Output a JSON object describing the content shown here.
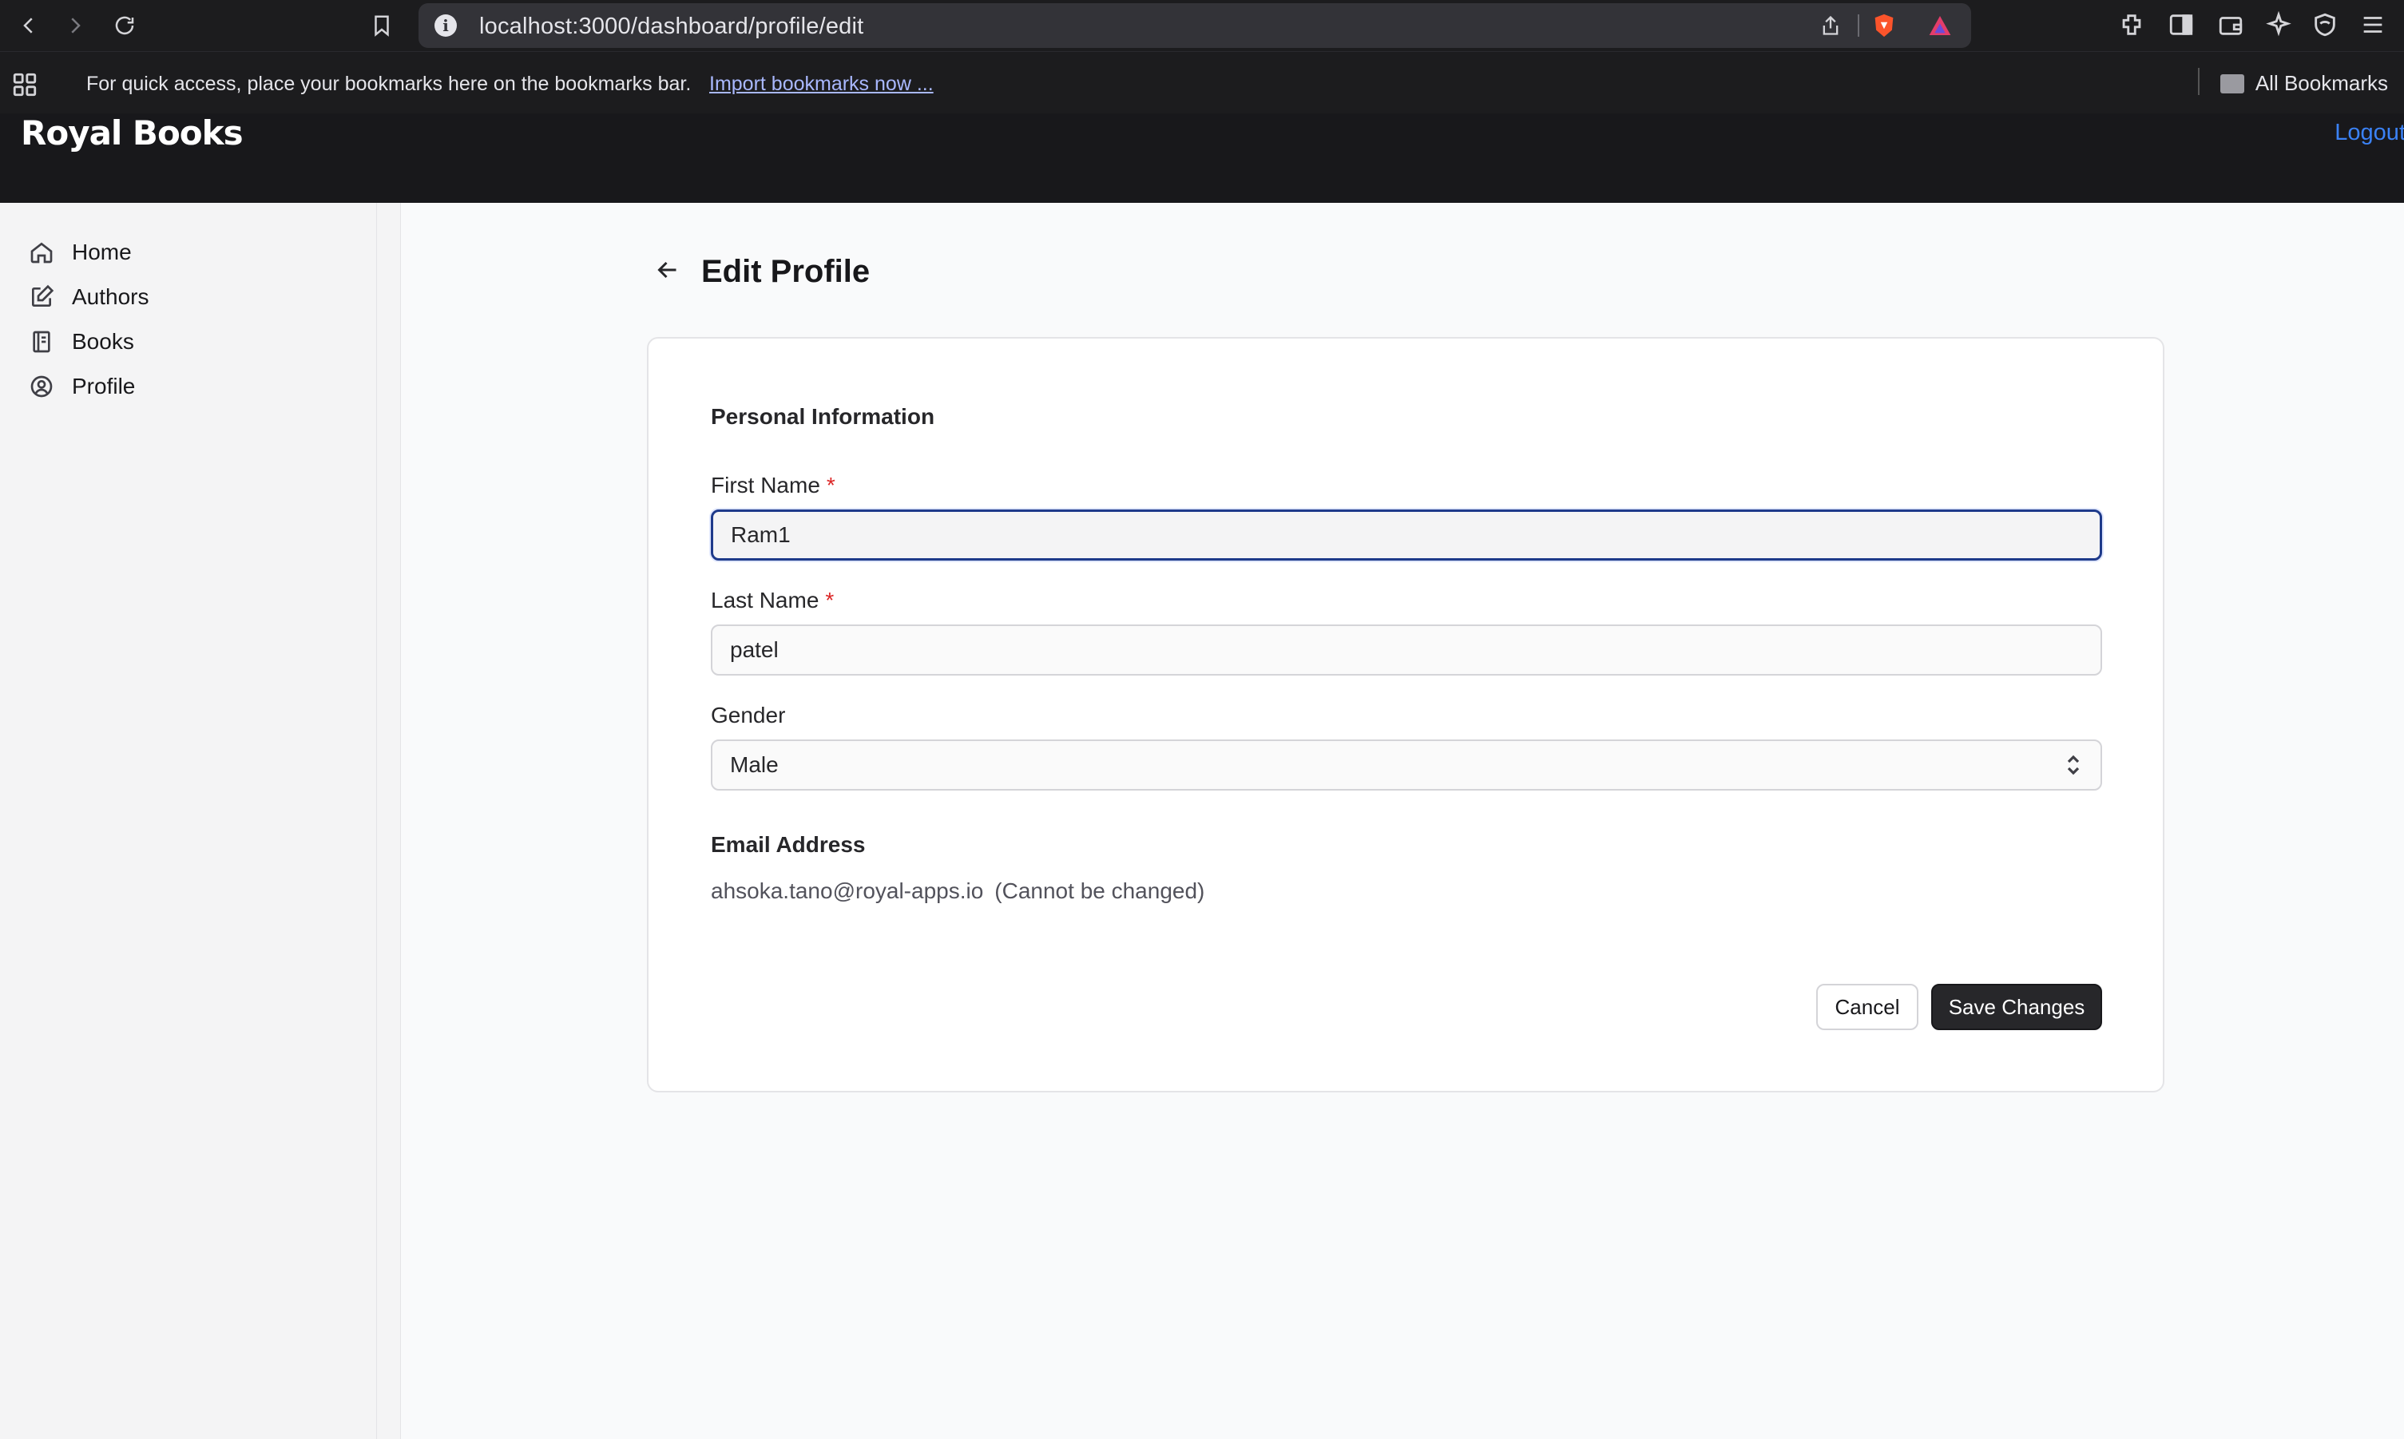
{
  "browser": {
    "url": "localhost:3000/dashboard/profile/edit",
    "bookmarks_prompt": "For quick access, place your bookmarks here on the bookmarks bar.",
    "import_link": "Import bookmarks now ...",
    "all_bookmarks": "All Bookmarks"
  },
  "header": {
    "logo": "Royal Books",
    "logout": "Logout"
  },
  "sidebar": {
    "items": [
      {
        "label": "Home",
        "icon": "home-icon"
      },
      {
        "label": "Authors",
        "icon": "edit-icon"
      },
      {
        "label": "Books",
        "icon": "book-icon"
      },
      {
        "label": "Profile",
        "icon": "user-circle-icon"
      }
    ]
  },
  "page": {
    "title": "Edit Profile"
  },
  "form": {
    "section_title": "Personal Information",
    "first_name_label": "First Name",
    "first_name_value": "Ram1",
    "last_name_label": "Last Name",
    "last_name_value": "patel",
    "required_mark": "*",
    "gender_label": "Gender",
    "gender_value": "Male",
    "email_label": "Email Address",
    "email_value": "ahsoka.tano@royal-apps.io",
    "email_note": "(Cannot be changed)",
    "cancel_label": "Cancel",
    "save_label": "Save Changes"
  },
  "colors": {
    "accent": "#1e3a8a",
    "link": "#3b82f6",
    "required": "#dc2626",
    "header_bg": "#18181b"
  }
}
